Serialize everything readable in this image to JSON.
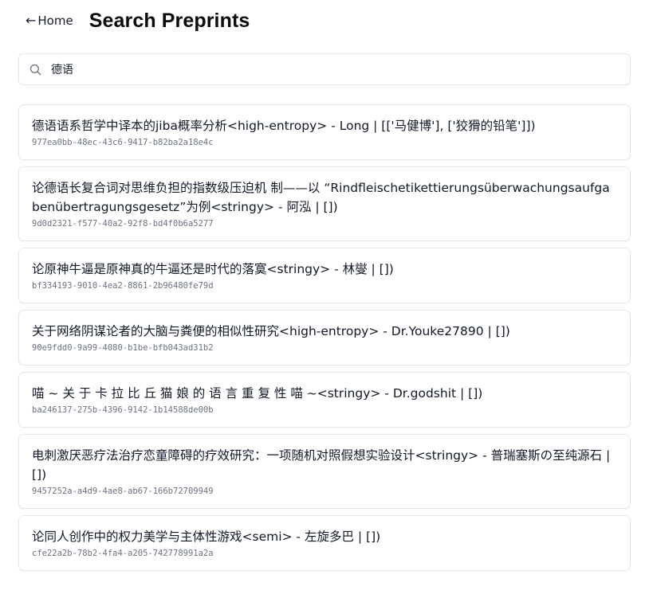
{
  "header": {
    "back_arrow": "←",
    "back_label": "Home",
    "title": "Search Preprints"
  },
  "search": {
    "icon": "search-icon",
    "value": "德语"
  },
  "results": [
    {
      "title": "德语语系哲学中译本的jiba概率分析<high-entropy> - Long | [['马健博'], ['狡猾的铅笔']])",
      "id": "977ea0bb-48ec-43c6-9417-b82ba2a18e4c"
    },
    {
      "title": "论德语长复合词对思维负担的指数级压迫机 制——以 “Rindfleischetikettierungsüberwachungsaufgabenübertragungsgesetz”为例<stringy> - 阿泓 | [])",
      "id": "9d0d2321-f577-40a2-92f8-bd4f0b6a5277"
    },
    {
      "title": "论原神牛逼是原神真的牛逼还是时代的落寞<stringy> - 林燮 | [])",
      "id": "bf334193-9010-4ea2-8861-2b96480fe79d"
    },
    {
      "title": "关于网络阴谋论者的大脑与粪便的相似性研究<high-entropy> - Dr.Youke27890 | [])",
      "id": "90e9fdd0-9a99-4080-b1be-bfb043ad31b2"
    },
    {
      "title": "喵 ~ 关 于 卡 拉 比 丘 猫 娘 的 语 言 重 复 性 喵 ~<stringy> - Dr.godshit | [])",
      "id": "ba246137-275b-4396-9142-1b14588de00b"
    },
    {
      "title": "电刺激厌恶疗法治疗恋童障碍的疗效研究：一项随机对照假想实验设计<stringy> - 普瑞塞斯の至纯源石 | [])",
      "id": "9457252a-a4d9-4ae8-ab67-166b72709949"
    },
    {
      "title": "论同人创作中的权力美学与主体性游戏<semi> - 左旋多巴 | [])",
      "id": "cfe22a2b-78b2-4fa4-a205-742778991a2a"
    }
  ]
}
